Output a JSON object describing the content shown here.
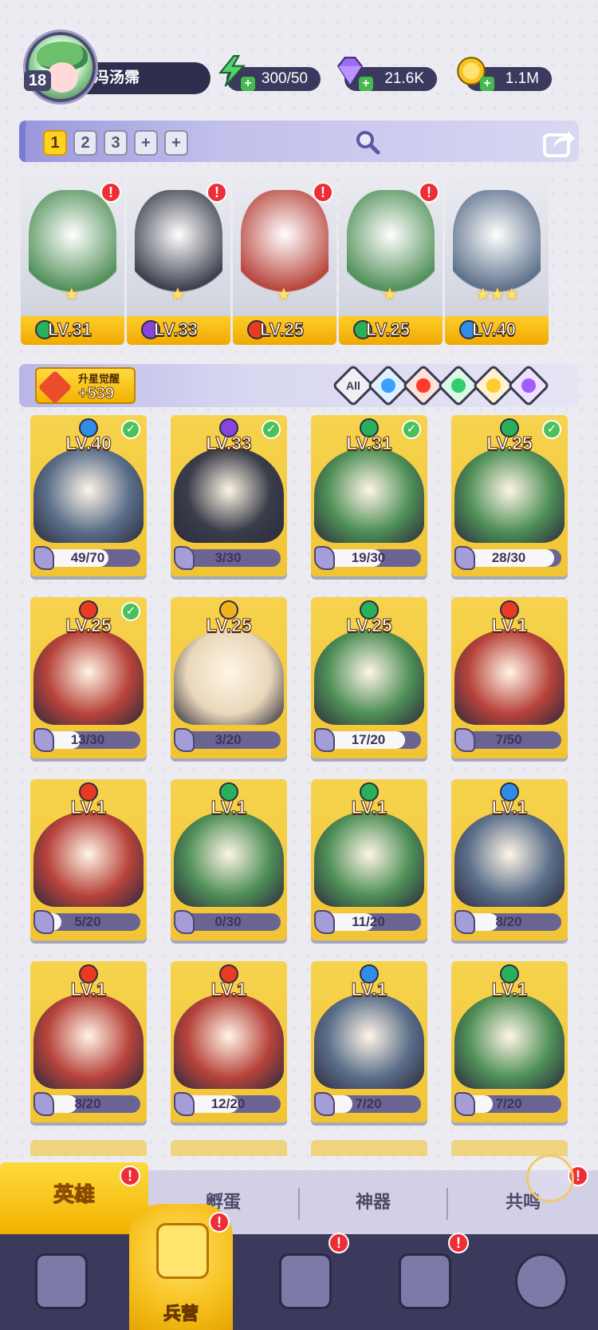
{
  "player": {
    "level": "18",
    "name": "冯汤霈"
  },
  "resources": [
    {
      "name": "energy",
      "icon": "lightning-icon",
      "value": "300/50",
      "color": "#49d06b"
    },
    {
      "name": "gems",
      "icon": "gem-icon",
      "value": "21.6K",
      "color": "#9b6bf2"
    },
    {
      "name": "gold",
      "icon": "coin-icon",
      "value": "1.1M",
      "color": "#f7c323"
    }
  ],
  "team_tabs": {
    "items": [
      "1",
      "2",
      "3",
      "+",
      "+"
    ],
    "active": "1"
  },
  "team": [
    {
      "level": "LV.31",
      "element": "wind",
      "alert": "!",
      "stars": 1
    },
    {
      "level": "LV.33",
      "element": "dark",
      "alert": "!",
      "stars": 1
    },
    {
      "level": "LV.25",
      "element": "fire",
      "alert": "!",
      "stars": 1
    },
    {
      "level": "LV.25",
      "element": "wind",
      "alert": "!",
      "stars": 1
    },
    {
      "level": "LV.40",
      "element": "water",
      "alert": "",
      "stars": 3
    }
  ],
  "upgrade": {
    "label": "升星觉醒",
    "value": "+539"
  },
  "filters": [
    {
      "name": "all",
      "label": "All"
    },
    {
      "name": "water",
      "color": "#3aa0ff"
    },
    {
      "name": "fire",
      "color": "#ff3b2b"
    },
    {
      "name": "wind",
      "color": "#2fcf6b"
    },
    {
      "name": "light",
      "color": "#ffcb2e"
    },
    {
      "name": "dark",
      "color": "#a35cff"
    }
  ],
  "element_colors": {
    "water": "#2f8de6",
    "fire": "#e83b22",
    "wind": "#29b05a",
    "light": "#f2b21d",
    "dark": "#8a44de"
  },
  "heroes": [
    {
      "level": "LV.40",
      "element": "water",
      "check": true,
      "progress": "49/70",
      "fraction": 0.7
    },
    {
      "level": "LV.33",
      "element": "dark",
      "check": true,
      "progress": "3/30",
      "fraction": 0.1
    },
    {
      "level": "LV.31",
      "element": "wind",
      "check": true,
      "progress": "19/30",
      "fraction": 0.63
    },
    {
      "level": "LV.25",
      "element": "wind",
      "check": true,
      "progress": "28/30",
      "fraction": 0.93
    },
    {
      "level": "LV.25",
      "element": "fire",
      "check": true,
      "progress": "13/30",
      "fraction": 0.43
    },
    {
      "level": "LV.25",
      "element": "light",
      "check": false,
      "progress": "3/20",
      "fraction": 0.15
    },
    {
      "level": "LV.25",
      "element": "wind",
      "check": false,
      "progress": "17/20",
      "fraction": 0.85
    },
    {
      "level": "LV.1",
      "element": "fire",
      "check": false,
      "progress": "7/50",
      "fraction": 0.14
    },
    {
      "level": "LV.1",
      "element": "fire",
      "check": false,
      "progress": "5/20",
      "fraction": 0.25
    },
    {
      "level": "LV.1",
      "element": "wind",
      "check": false,
      "progress": "0/30",
      "fraction": 0
    },
    {
      "level": "LV.1",
      "element": "wind",
      "check": false,
      "progress": "11/20",
      "fraction": 0.55
    },
    {
      "level": "LV.1",
      "element": "water",
      "check": false,
      "progress": "8/20",
      "fraction": 0.4
    },
    {
      "level": "LV.1",
      "element": "fire",
      "check": false,
      "progress": "8/20",
      "fraction": 0.4
    },
    {
      "level": "LV.1",
      "element": "fire",
      "check": false,
      "progress": "12/20",
      "fraction": 0.6
    },
    {
      "level": "LV.1",
      "element": "water",
      "check": false,
      "progress": "7/20",
      "fraction": 0.35
    },
    {
      "level": "LV.1",
      "element": "wind",
      "check": false,
      "progress": "7/20",
      "fraction": 0.35
    }
  ],
  "sub_tabs": {
    "hero": "英雄",
    "hatch": "孵蛋",
    "artifact": "神器",
    "resonance": "共鸣",
    "alert": "!"
  },
  "nav": {
    "barracks": "兵营",
    "alert": "!"
  }
}
